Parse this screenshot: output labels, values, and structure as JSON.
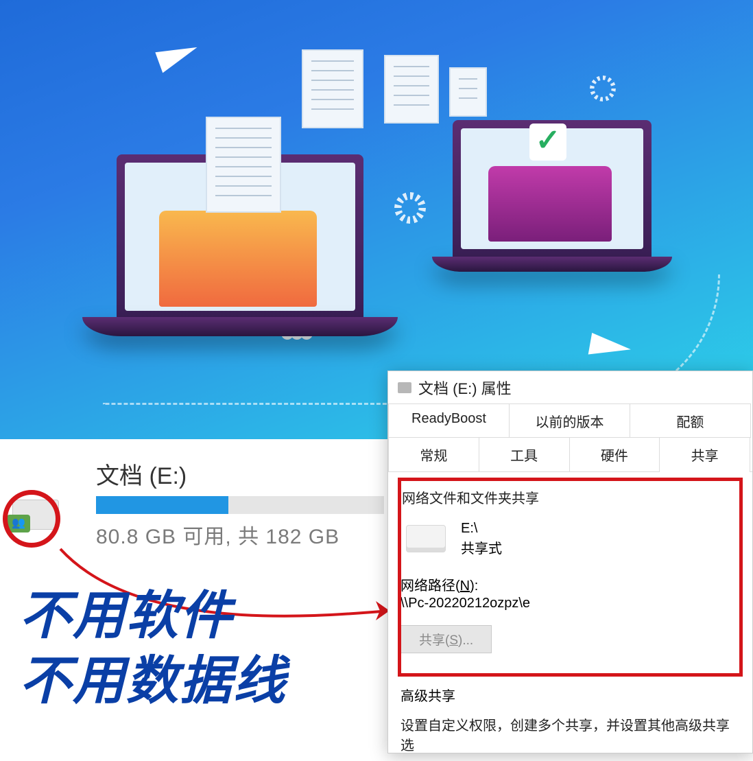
{
  "drive": {
    "label": "文档 (E:)",
    "free": "80.8 GB 可用, 共 182 GB",
    "fill_percent": 46
  },
  "captions": {
    "line1": "不用软件",
    "line2": "不用数据线"
  },
  "props": {
    "title": "文档 (E:) 属性",
    "tabs_row1": [
      "ReadyBoost",
      "以前的版本",
      "配额"
    ],
    "tabs_row2": [
      "常规",
      "工具",
      "硬件",
      "共享"
    ],
    "active_tab": "共享",
    "group_label": "网络文件和文件夹共享",
    "share_path": "E:\\",
    "share_status": "共享式",
    "net_label": "网络路径(N):",
    "net_path": "\\\\Pc-20220212ozpz\\e",
    "share_button": "共享(S)...",
    "adv_label": "高级共享",
    "adv_desc": "设置自定义权限，创建多个共享，并设置其他高级共享选"
  }
}
